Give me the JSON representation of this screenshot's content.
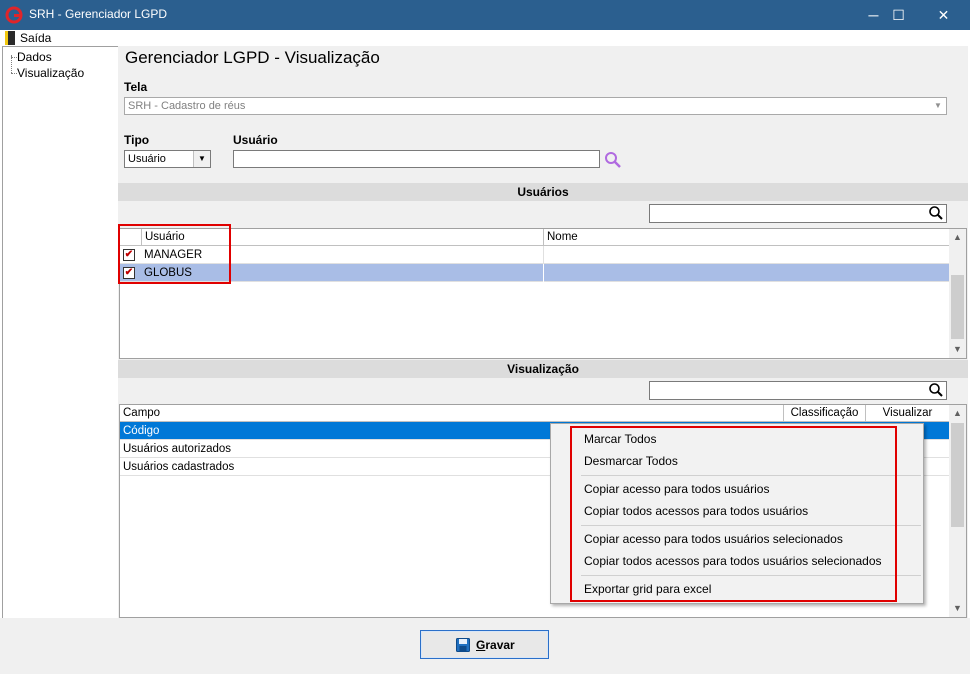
{
  "window": {
    "title": "SRH - Gerenciador LGPD",
    "minimize": "─",
    "maximize": "☐",
    "close": "✕"
  },
  "menu": {
    "saida": "Saída"
  },
  "sidebar": {
    "items": [
      {
        "label": "Dados"
      },
      {
        "label": "Visualização"
      }
    ]
  },
  "main": {
    "title": "Gerenciador LGPD - Visualização",
    "tela_label": "Tela",
    "tela_value": "SRH - Cadastro de réus",
    "tipo_label": "Tipo",
    "tipo_value": "Usuário",
    "usuario_label": "Usuário",
    "usuario_value": ""
  },
  "usuarios_section": {
    "header": "Usuários",
    "search_value": "",
    "columns": [
      "Usuário",
      "Nome"
    ],
    "rows": [
      {
        "checked": true,
        "usuario": "MANAGER",
        "nome": ""
      },
      {
        "checked": true,
        "usuario": "GLOBUS",
        "nome": ""
      }
    ]
  },
  "visualizacao_section": {
    "header": "Visualização",
    "search_value": "",
    "columns": [
      "Campo",
      "Classificação",
      "Visualizar"
    ],
    "rows": [
      {
        "campo": "Código"
      },
      {
        "campo": "Usuários autorizados"
      },
      {
        "campo": "Usuários cadastrados"
      }
    ]
  },
  "context_menu": {
    "items": [
      "Marcar Todos",
      "Desmarcar Todos",
      "Copiar acesso para todos usuários",
      "Copiar todos acessos para todos usuários",
      "Copiar acesso para todos usuários selecionados",
      "Copiar todos acessos para todos usuários selecionados",
      "Exportar grid para excel"
    ]
  },
  "footer": {
    "gravar_label": "Gravar",
    "gravar_mnemonic": "G",
    "gravar_rest": "ravar"
  },
  "icons": {
    "search": "search-icon",
    "save": "save-icon",
    "app": "app-logo-icon",
    "exit": "exit-door-icon"
  },
  "colors": {
    "titlebar": "#2b5f8f",
    "selection": "#0078d7",
    "row_highlight": "#a9bde6",
    "red_annotation": "#e00000"
  }
}
